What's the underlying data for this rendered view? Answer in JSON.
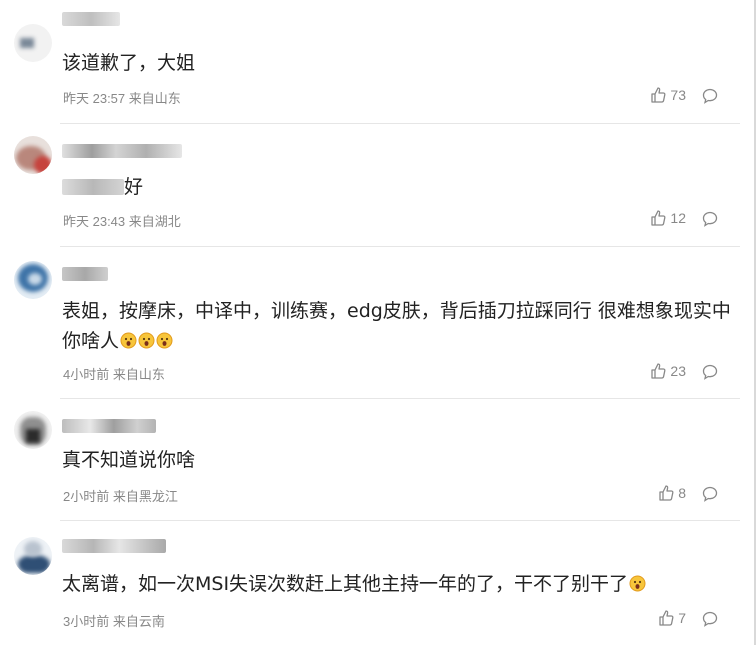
{
  "comments": [
    {
      "text": "该道歉了，大姐",
      "time": "昨天 23:57 来自山东",
      "likes": "73"
    },
    {
      "text": "好",
      "time": "昨天 23:43 来自湖北",
      "likes": "12"
    },
    {
      "text": "表姐，按摩床，中译中，训练赛，edg皮肤，背后插刀拉踩同行 很难想象现实中你啥人",
      "time": "4小时前 来自山东",
      "likes": "23"
    },
    {
      "text": "真不知道说你啥",
      "time": "2小时前 来自黑龙江",
      "likes": "8"
    },
    {
      "text": "太离谱，如一次MSI失误次数赶上其他主持一年的了，干不了别干了",
      "time": "3小时前 来自云南",
      "likes": "7"
    }
  ],
  "icons": {
    "like": "thumbs-up-icon",
    "reply": "comment-bubble-icon",
    "emoji": "scared-face-emoji"
  },
  "colors": {
    "meta": "#888888",
    "divider": "#e6e6e6"
  }
}
